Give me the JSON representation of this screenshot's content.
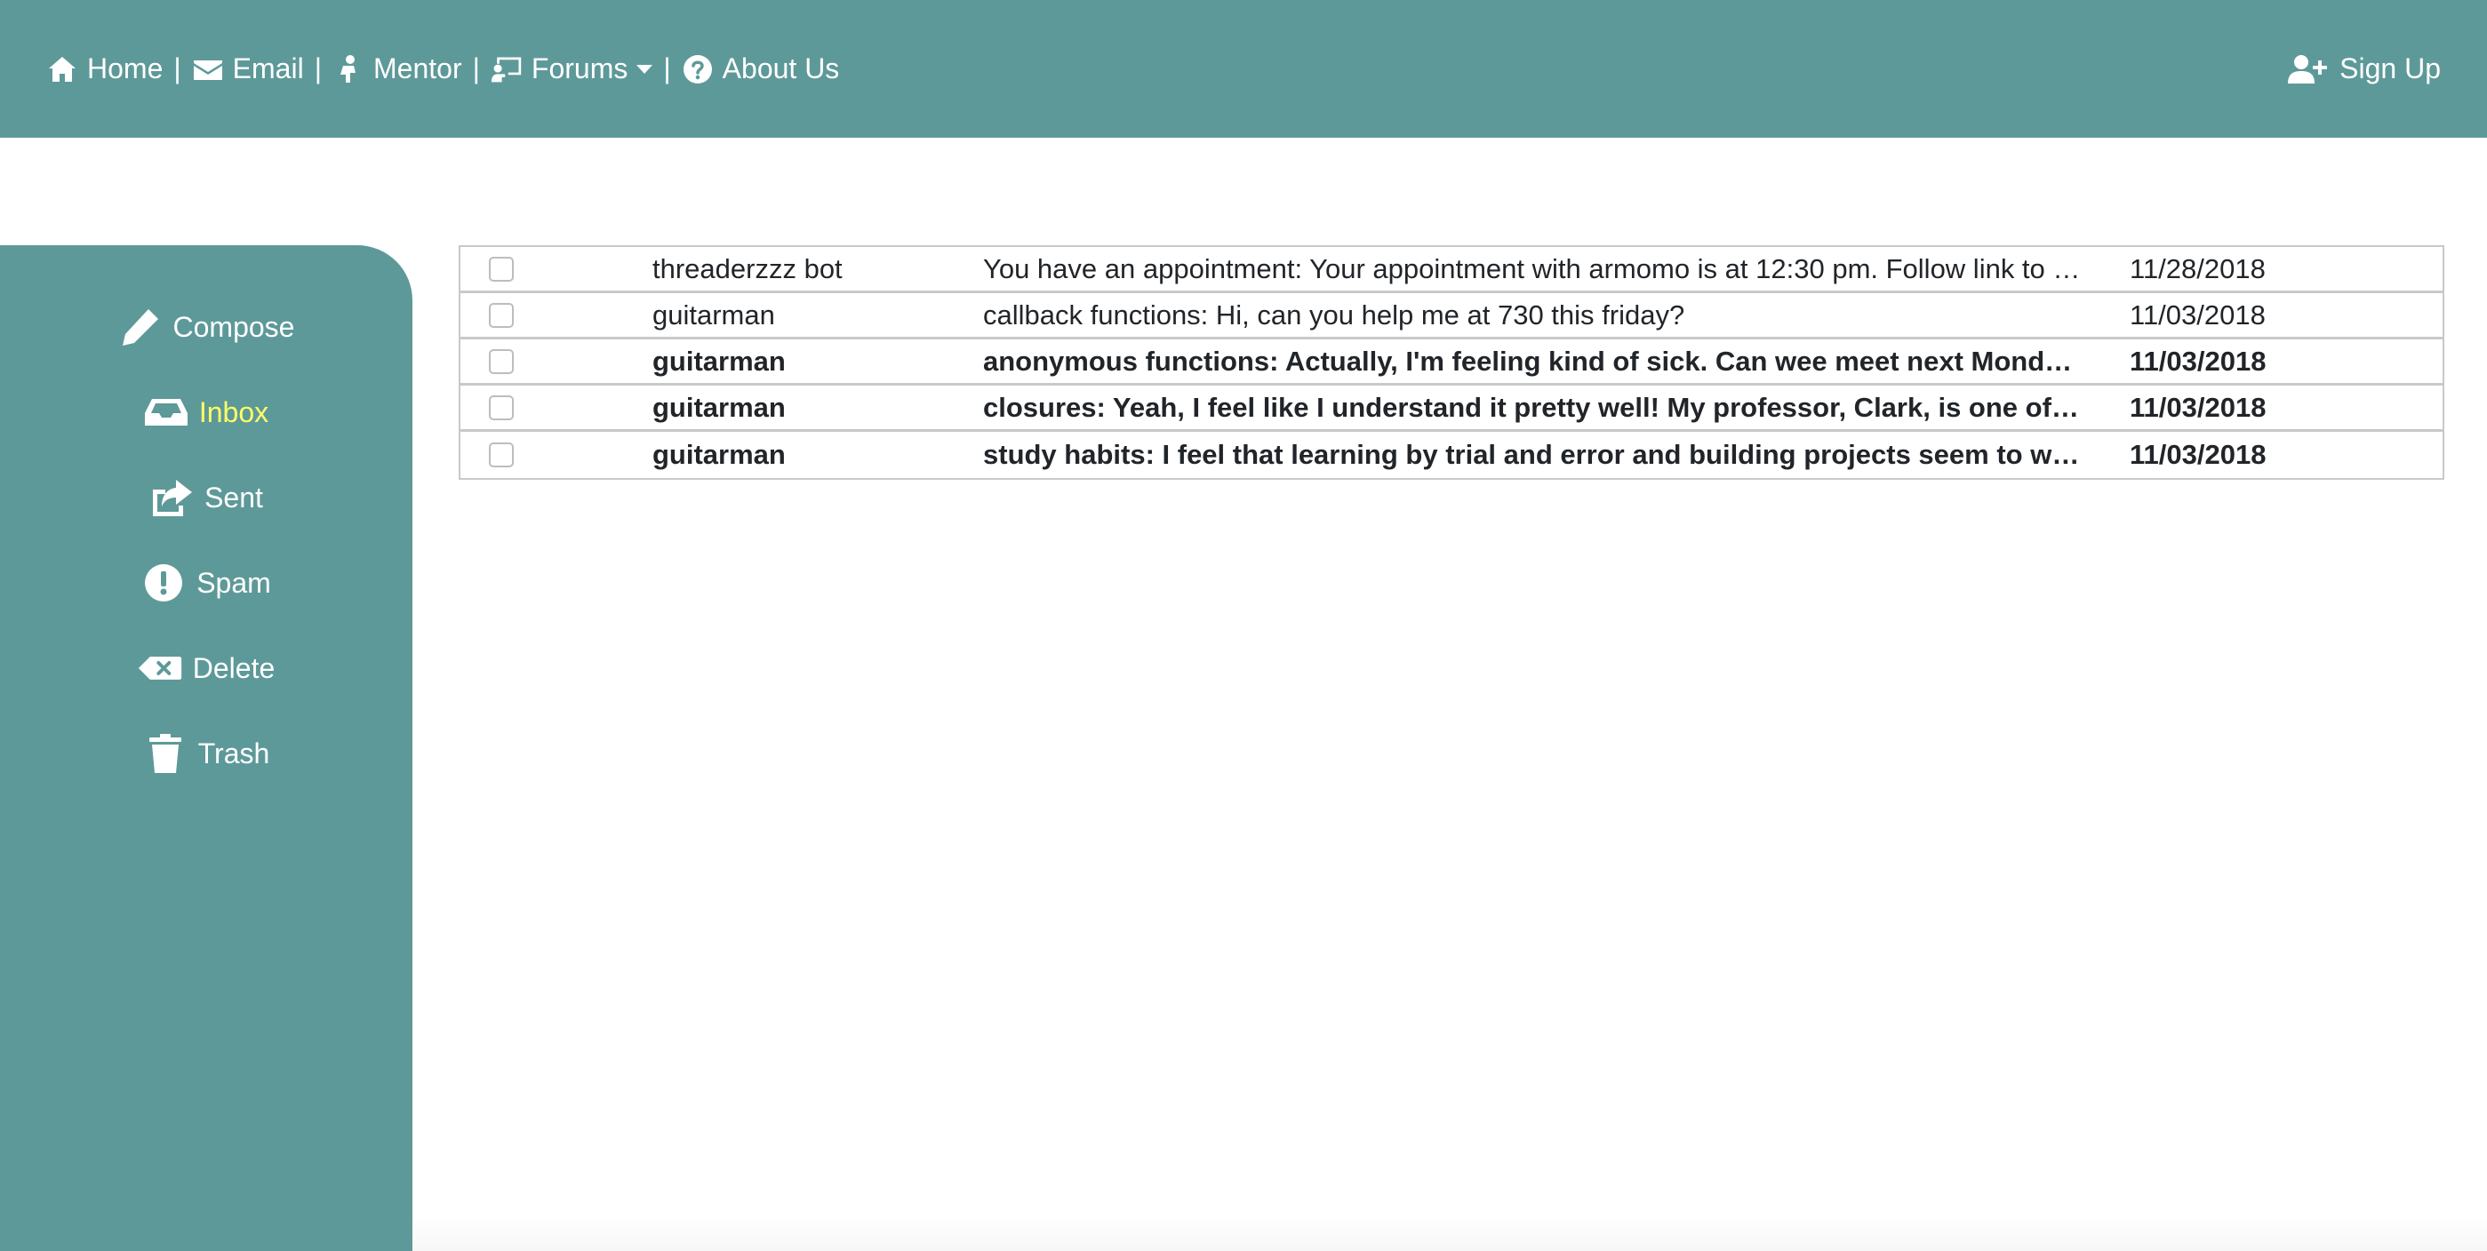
{
  "nav": {
    "items": [
      {
        "label": "Home",
        "icon": "home-icon"
      },
      {
        "label": "Email",
        "icon": "envelope-icon"
      },
      {
        "label": "Mentor",
        "icon": "mentor-icon"
      },
      {
        "label": "Forums",
        "icon": "chalkboard-teacher-icon"
      },
      {
        "label": "About Us",
        "icon": "question-circle-icon"
      }
    ],
    "separator": "|",
    "signup": {
      "label": "Sign Up",
      "icon": "user-plus-icon"
    }
  },
  "sidebar": {
    "items": [
      {
        "label": "Compose",
        "icon": "pencil-icon"
      },
      {
        "label": "Inbox",
        "icon": "inbox-icon",
        "active": true
      },
      {
        "label": "Sent",
        "icon": "share-icon"
      },
      {
        "label": "Spam",
        "icon": "exclamation-circle-icon"
      },
      {
        "label": "Delete",
        "icon": "backspace-icon"
      },
      {
        "label": "Trash",
        "icon": "trash-icon"
      }
    ]
  },
  "messages": [
    {
      "sender": "threaderzzz bot",
      "subject": "You have an appointment:  Your appointment with armomo is at 12:30 pm. Follow link to join the meeting",
      "date": "11/28/2018",
      "unread": false
    },
    {
      "sender": "guitarman",
      "subject": "callback functions:  Hi, can you help me at 730 this friday?",
      "date": "11/03/2018",
      "unread": false
    },
    {
      "sender": "guitarman",
      "subject": "anonymous functions:  Actually, I'm feeling kind of sick. Can wee meet next Monday instead?",
      "date": "11/03/2018",
      "unread": true
    },
    {
      "sender": "guitarman",
      "subject": "closures:  Yeah, I feel like I understand it pretty well! My professor, Clark, is one of the best",
      "date": "11/03/2018",
      "unread": true
    },
    {
      "sender": "guitarman",
      "subject": "study habits:  I feel that learning by trial and error and building projects seem to work best",
      "date": "11/03/2018",
      "unread": true
    }
  ],
  "colors": {
    "primary": "#5e9999",
    "active_text": "#ffff66",
    "text": "#212529"
  }
}
